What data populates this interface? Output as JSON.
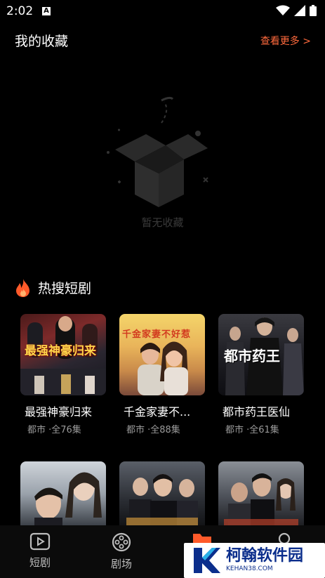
{
  "status": {
    "time": "2:02",
    "a_badge": "A"
  },
  "favorites": {
    "title": "我的收藏",
    "more": "查看更多 >",
    "empty_text": "暂无收藏"
  },
  "hot": {
    "title": "热搜短剧",
    "items": [
      {
        "title": "最强神豪归来",
        "meta": "都市 ·全76集",
        "poster_text": "最强神豪归来"
      },
      {
        "title": "千金家妻不...",
        "meta": "都市 ·全88集",
        "poster_text": "千金家妻不好惹"
      },
      {
        "title": "都市药王医仙",
        "meta": "都市 ·全61集",
        "poster_text": "都市药王"
      }
    ]
  },
  "nav": {
    "items": [
      {
        "label": "短剧"
      },
      {
        "label": "剧场"
      }
    ]
  },
  "watermark": {
    "brand": "柯翰软件园",
    "url": "KEHAN38.COM"
  },
  "colors": {
    "accent": "#ff6a3d",
    "background": "#000000"
  }
}
